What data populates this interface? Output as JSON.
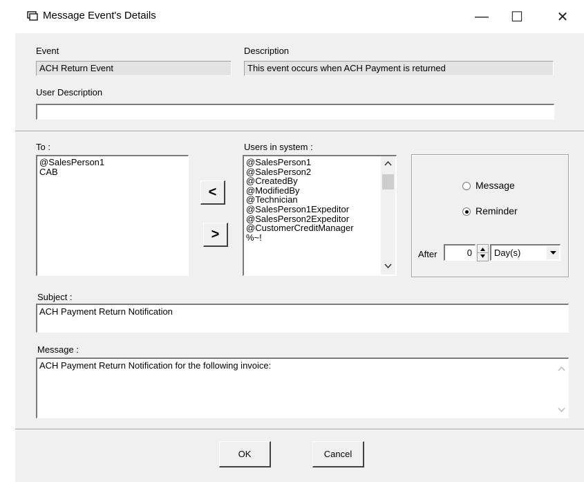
{
  "window": {
    "title": "Message Event's Details",
    "minimize_glyph": "—",
    "maximize_glyph": "☐",
    "close_glyph": "✕"
  },
  "event": {
    "label": "Event",
    "value": "ACH Return Event"
  },
  "description": {
    "label": "Description",
    "value": "This event occurs when ACH Payment is returned"
  },
  "user_description": {
    "label": "User Description",
    "value": ""
  },
  "to": {
    "label": "To :",
    "items": [
      "@SalesPerson1",
      "CAB"
    ]
  },
  "users": {
    "label": "Users in system :",
    "items": [
      "@SalesPerson1",
      "@SalesPerson2",
      "@CreatedBy",
      "@ModifiedBy",
      "@Technician",
      "@SalesPerson1Expeditor",
      "@SalesPerson2Expeditor",
      "@CustomerCreditManager",
      "%~!"
    ]
  },
  "move": {
    "add_label": "<",
    "remove_label": ">"
  },
  "type": {
    "message_label": "Message",
    "reminder_label": "Reminder",
    "selected": "Reminder"
  },
  "after": {
    "label": "After",
    "value": "0",
    "unit": "Day(s)"
  },
  "subject": {
    "label": "Subject :",
    "value": "ACH Payment Return Notification"
  },
  "message": {
    "label": "Message :",
    "value": "ACH Payment Return Notification for the following invoice:"
  },
  "buttons": {
    "ok": "OK",
    "cancel": "Cancel"
  }
}
